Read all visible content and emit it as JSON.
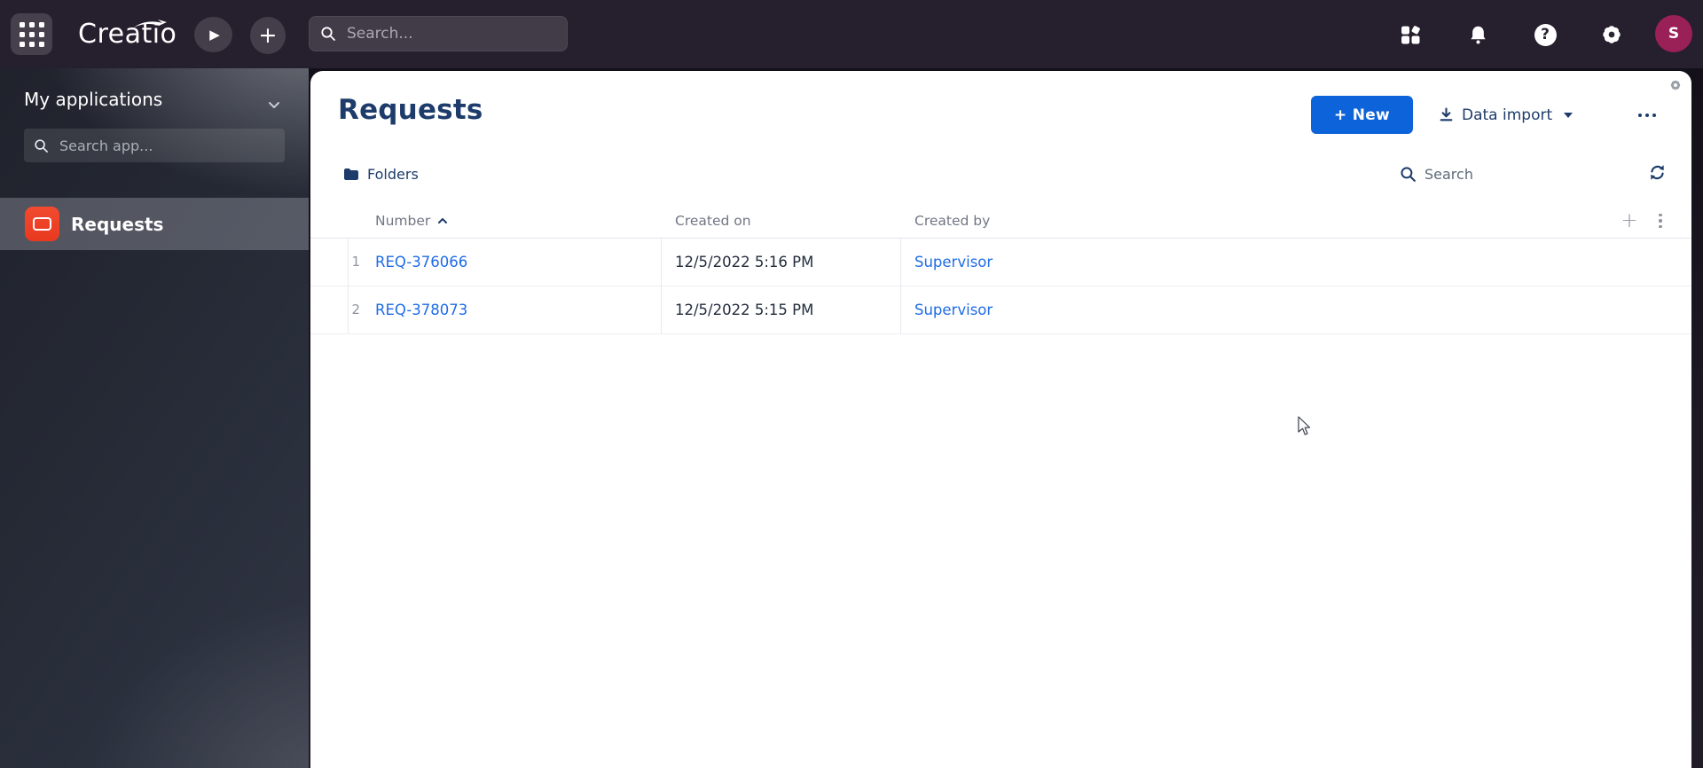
{
  "topbar": {
    "logo_text": "Creatio",
    "search_placeholder": "Search...",
    "play_glyph": "▶",
    "plus_glyph": "+",
    "help_glyph": "?",
    "avatar_initial": "S"
  },
  "sidebar": {
    "title": "My applications",
    "search_placeholder": "Search app...",
    "items": [
      {
        "label": "Requests",
        "selected": true
      }
    ]
  },
  "page": {
    "title": "Requests",
    "new_button_label": "+ New",
    "data_import_label": "Data import",
    "folders_label": "Folders",
    "search_label": "Search"
  },
  "table": {
    "columns": [
      "Number",
      "Created on",
      "Created by"
    ],
    "sorted_by": "Number",
    "sort_direction": "ascending",
    "add_column_glyph": "+",
    "rows": [
      {
        "index": "1",
        "number": "REQ-376066",
        "created_on": "12/5/2022 5:16 PM",
        "created_by": "Supervisor"
      },
      {
        "index": "2",
        "number": "REQ-378073",
        "created_on": "12/5/2022 5:15 PM",
        "created_by": "Supervisor"
      }
    ]
  },
  "colors": {
    "accent_blue": "#0d63d9",
    "link_blue": "#1f6ce8",
    "navy_text": "#1e3c6b",
    "header_gray": "#6f7784",
    "app_icon_red": "#e9391f",
    "avatar_magenta": "#9a2058"
  }
}
